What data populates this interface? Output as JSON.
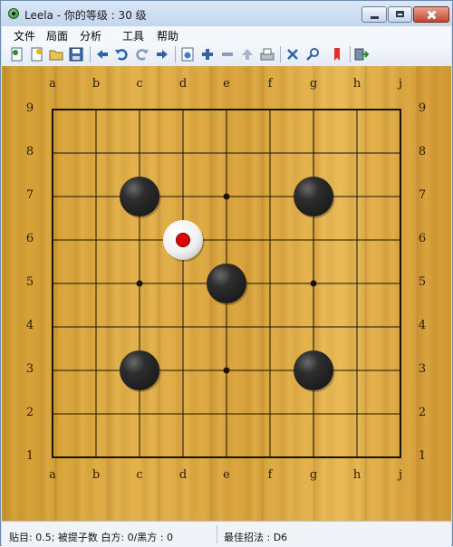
{
  "window": {
    "title": "Leela - 你的等级 : 30 级"
  },
  "menu": [
    "文件",
    "局面",
    "分析",
    "工具",
    "帮助"
  ],
  "toolbar": [
    "new-game-icon",
    "new-position-icon",
    "open-icon",
    "save-icon",
    "back-icon",
    "undo-icon",
    "redo-icon",
    "forward-icon",
    "settings-icon",
    "zoom-in-icon",
    "zoom-out-icon",
    "up-icon",
    "print-icon",
    "analyze-icon",
    "search-icon",
    "bookmark-icon",
    "exit-icon"
  ],
  "board": {
    "size": 9,
    "columns": [
      "a",
      "b",
      "c",
      "d",
      "e",
      "f",
      "g",
      "h",
      "j"
    ],
    "rows": [
      "9",
      "8",
      "7",
      "6",
      "5",
      "4",
      "3",
      "2",
      "1"
    ],
    "star_points": [
      "c5",
      "e7",
      "e5",
      "e3",
      "g5"
    ],
    "stones": [
      {
        "point": "c7",
        "color": "black"
      },
      {
        "point": "g7",
        "color": "black"
      },
      {
        "point": "e5",
        "color": "black"
      },
      {
        "point": "c3",
        "color": "black"
      },
      {
        "point": "g3",
        "color": "black"
      },
      {
        "point": "d6",
        "color": "white",
        "last_move": true
      }
    ],
    "colors": {
      "black_stone": "#1c1c1c",
      "white_stone": "#ffffff",
      "last_move_marker": "#e00000"
    }
  },
  "status": {
    "komi": "贴目: 0.5; 被提子数 白方: 0/黑方  : 0",
    "best_move": "最佳招法 : D6"
  }
}
